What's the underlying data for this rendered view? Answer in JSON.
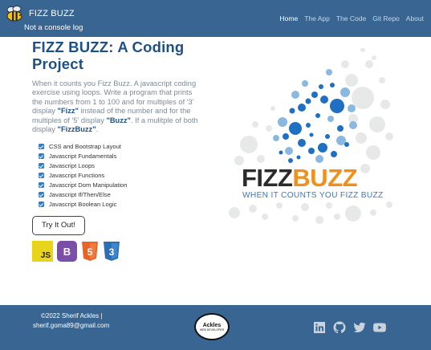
{
  "navbar": {
    "brand": "FIZZ BUZZ",
    "tagline": "Not a console log",
    "links": [
      {
        "label": "Home",
        "active": true
      },
      {
        "label": "The App",
        "active": false
      },
      {
        "label": "The Code",
        "active": false
      },
      {
        "label": "Git Repo",
        "active": false
      },
      {
        "label": "About",
        "active": false
      }
    ]
  },
  "main": {
    "title": "FIZZ BUZZ: A Coding Project",
    "description": {
      "p1": "When it counts you Fizz Buzz. A javascript coding exercise using loops. Write a program that prints the numbers from 1 to 100 and for multiples of '3' display ",
      "fizz": "\"Fizz\"",
      "p2": " instead of the number and for the multiples of '5' display ",
      "buzz": "\"Buzz\"",
      "p3": ". If a mulitple of both display ",
      "fizzbuzz": "\"FizzBuzz\"",
      "p4": "."
    },
    "features": [
      "CSS and Bootstrap Layout",
      "Javascript Fundamentals",
      "Javascript Loops",
      "Javascript Functions",
      "Javascript Dom Manipulation",
      "Javascript If/Then/Else",
      "Javascript Boolean Logic"
    ],
    "try_button": "Try It Out!",
    "tech_icons": [
      {
        "name": "javascript-icon",
        "text": "JS",
        "color": "#e8d51b"
      },
      {
        "name": "bootstrap-icon",
        "text": "B",
        "color": "#7b4ea8"
      },
      {
        "name": "html5-icon",
        "text": "5",
        "color": "#e96228"
      },
      {
        "name": "css3-icon",
        "text": "3",
        "color": "#2c6db4"
      }
    ]
  },
  "logo": {
    "fizz": "FIZZ",
    "buzz": "BUZZ",
    "subtitle": "WHEN IT COUNTS YOU FIZZ BUZZ",
    "colors": {
      "dark": "#2b2b2b",
      "orange": "#f0901c",
      "blue": "#3a78c2",
      "bubble_blue": "#1f6fc2",
      "bubble_light": "#8ab8e0",
      "bubble_gray": "#e3e6e4"
    }
  },
  "footer": {
    "copyright": "©2022 Sherif Ackles |",
    "email": "sherif.goma89@gmail.com",
    "logo_name": "Ackles",
    "logo_sub": "WEB DEVELOPER",
    "social": [
      "linkedin-icon",
      "github-icon",
      "twitter-icon",
      "youtube-icon"
    ]
  },
  "colors": {
    "navbar_bg": "#386592",
    "title": "#1e5085",
    "accent_check": "#2f7cd0"
  }
}
